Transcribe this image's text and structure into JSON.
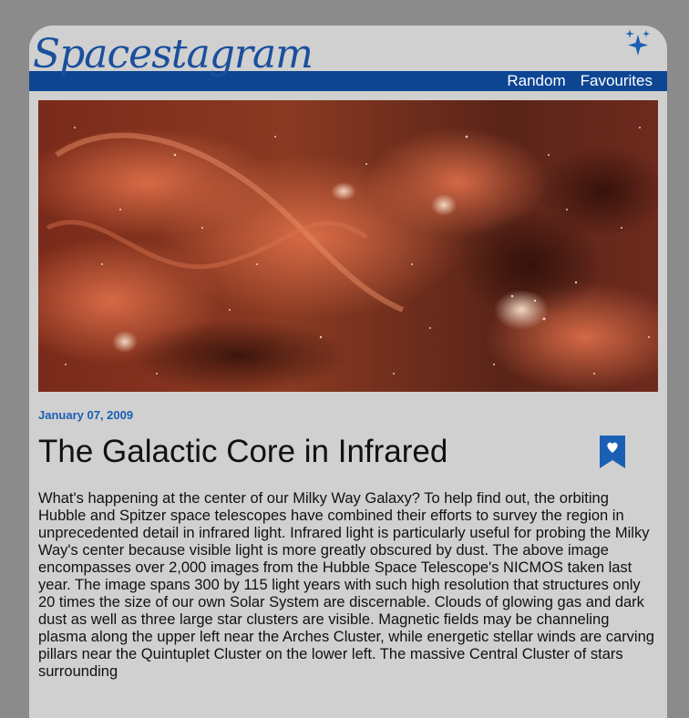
{
  "header": {
    "logo": "Spacestagram",
    "nav": [
      {
        "label": "Random"
      },
      {
        "label": "Favourites"
      }
    ],
    "icon": "sparkles-icon"
  },
  "post": {
    "date": "January 07, 2009",
    "title": "The Galactic Core in Infrared",
    "bookmark_icon": "bookmark-heart-icon",
    "explanation": "What's happening at the center of our Milky Way Galaxy? To help find out, the orbiting Hubble and Spitzer space telescopes have combined their efforts to survey the region in unprecedented detail in infrared light. Infrared light is particularly useful for probing the Milky Way's center because visible light is more greatly obscured by dust. The above image encompasses over 2,000 images from the Hubble Space Telescope's NICMOS taken last year. The image spans 300 by 115 light years with such high resolution that structures only 20 times the size of our own Solar System are discernable. Clouds of glowing gas and dark dust as well as three large star clusters are visible. Magnetic fields may be channeling plasma along the upper left near the Arches Cluster, while energetic stellar winds are carving pillars near the Quintuplet Cluster on the lower left. The massive Central Cluster of stars surrounding"
  },
  "colors": {
    "brand": "#0d4593",
    "date": "#1a5fb4",
    "card": "#d0d0d0",
    "background": "#8b8b8b"
  }
}
